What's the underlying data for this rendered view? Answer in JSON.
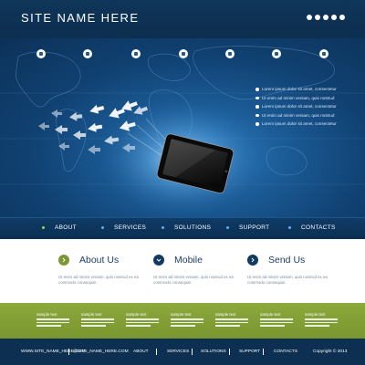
{
  "header": {
    "site_name": "SITE  NAME  HERE",
    "social_icons": [
      "social-icon-1",
      "social-icon-2",
      "social-icon-3",
      "social-icon-4",
      "social-icon-5"
    ]
  },
  "hero": {
    "top_icons": [
      "phone-icon",
      "document-icon",
      "globe-icon",
      "search-icon",
      "mail-icon",
      "chat-icon",
      "lock-icon"
    ],
    "bullets": [
      "Lorem ipsum dolor sit amet, consectetur",
      "Ut enim ad minim veniam, quis nostrud",
      "Lorem ipsum dolor sit amet, consectetur",
      "Ut enim ad minim veniam, quis nostrud",
      "Lorem ipsum dolor sit amet, consectetur"
    ]
  },
  "nav": {
    "items": [
      "ABOUT",
      "SERVICES",
      "SOLUTIONS",
      "SUPPORT",
      "CONTACTS"
    ]
  },
  "features": [
    {
      "title": "About Us",
      "text": "Ut enim ad minim veniam, quis nostrud ex ea commodo consequat.",
      "icon": "chevron-right-icon"
    },
    {
      "title": "Mobile",
      "text": "Ut enim ad minim veniam, quis nostrud ex ea commodo consequat.",
      "icon": "chevron-down-icon"
    },
    {
      "title": "Send Us",
      "text": "Ut enim ad minim veniam, quis nostrud ex ea commodo consequat.",
      "icon": "chevron-right-icon"
    }
  ],
  "band": {
    "columns": [
      "sample text",
      "sample text",
      "sample text",
      "sample text",
      "sample text",
      "sample text",
      "sample text"
    ]
  },
  "footer": {
    "url": "WWW.SITE_NAME_HERE.COM",
    "handle": "@SITE_NAME_HERE.COM",
    "links": [
      "ABOUT",
      "SERVICES",
      "SOLUTIONS",
      "SUPPORT",
      "CONTACTS"
    ],
    "copyright": "Copyright © 2013"
  },
  "colors": {
    "header_bg": "#0f3559",
    "hero_bg": "#1b5b96",
    "accent_green": "#7d9636",
    "nav_dot_green": "#9fd34c",
    "nav_dot_blue": "#5fb0ea",
    "footer_bg": "#0d2f52"
  }
}
